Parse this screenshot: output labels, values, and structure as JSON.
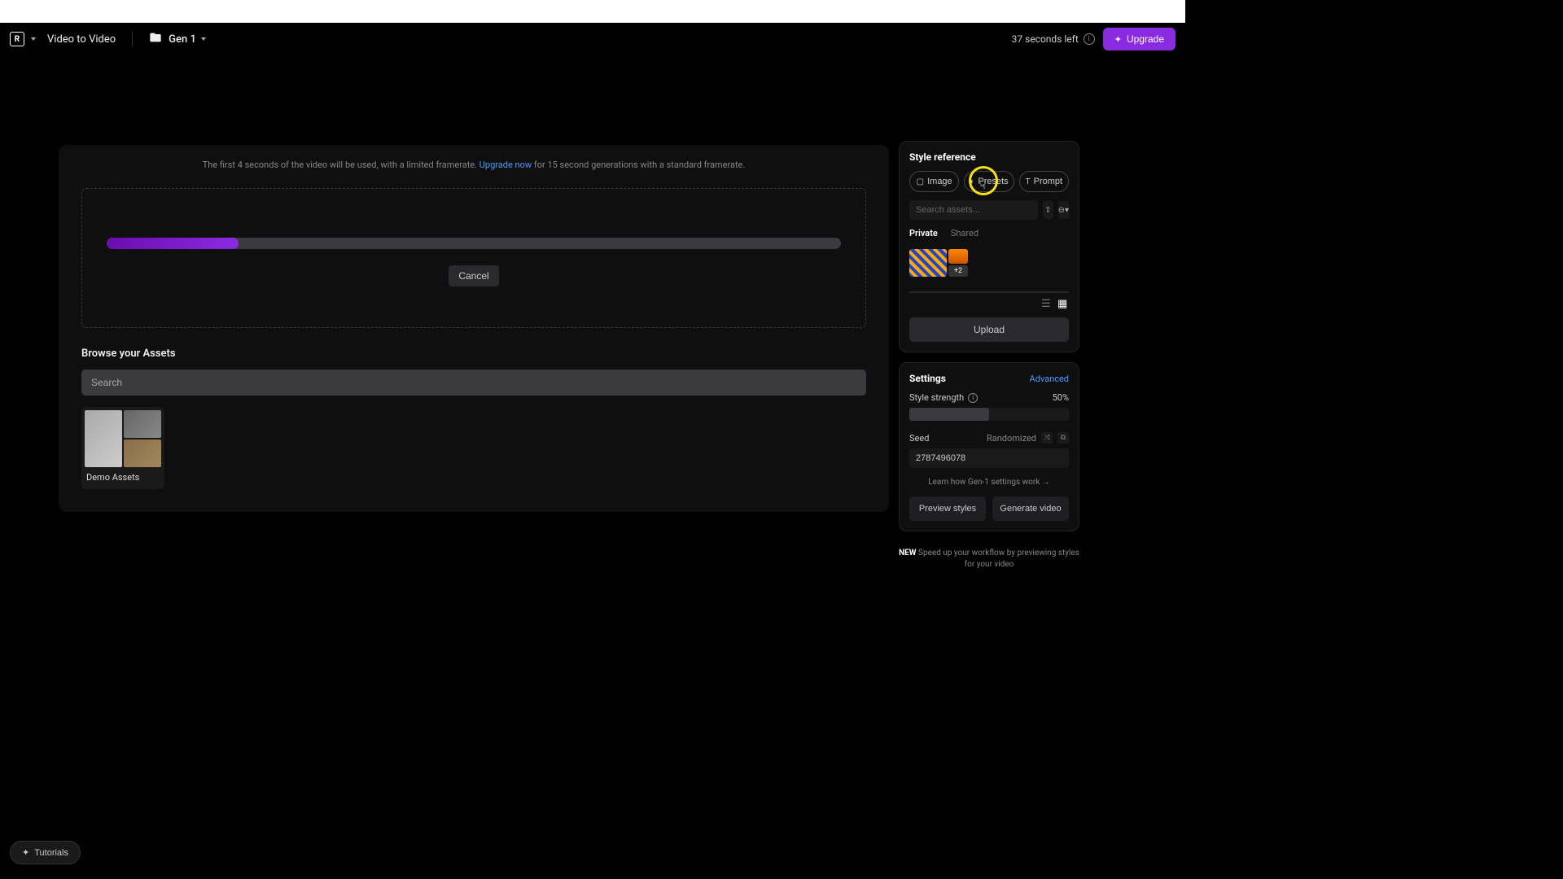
{
  "header": {
    "logo_text": "R",
    "title": "Video to Video",
    "gen_label": "Gen 1",
    "seconds_left": "37 seconds left",
    "upgrade_label": "Upgrade"
  },
  "upload": {
    "framerate_text_1": "The first 4 seconds of the video will be used, with a limited framerate. ",
    "framerate_link": "Upgrade now",
    "framerate_text_2": " for 15 second generations with a standard framerate.",
    "progress_percent": 18,
    "cancel_label": "Cancel"
  },
  "browse": {
    "title": "Browse your Assets",
    "search_placeholder": "Search",
    "folder_name": "Demo Assets"
  },
  "style_ref": {
    "title": "Style reference",
    "pills": {
      "image": "Image",
      "presets": "Presets",
      "prompt": "Prompt"
    },
    "search_placeholder": "Search assets...",
    "tabs": {
      "private": "Private",
      "shared": "Shared"
    },
    "more_count": "+2",
    "upload_label": "Upload"
  },
  "settings": {
    "title": "Settings",
    "advanced": "Advanced",
    "strength_label": "Style strength",
    "strength_value": "50%",
    "seed_label": "Seed",
    "randomized": "Randomized",
    "seed_value": "2787496078",
    "learn_link": "Learn how Gen-1 settings work →"
  },
  "actions": {
    "preview": "Preview styles",
    "generate": "Generate video",
    "new_tip_tag": "NEW",
    "new_tip_text": " Speed up your workflow by previewing styles for your video"
  },
  "tutorials": {
    "label": "Tutorials"
  }
}
